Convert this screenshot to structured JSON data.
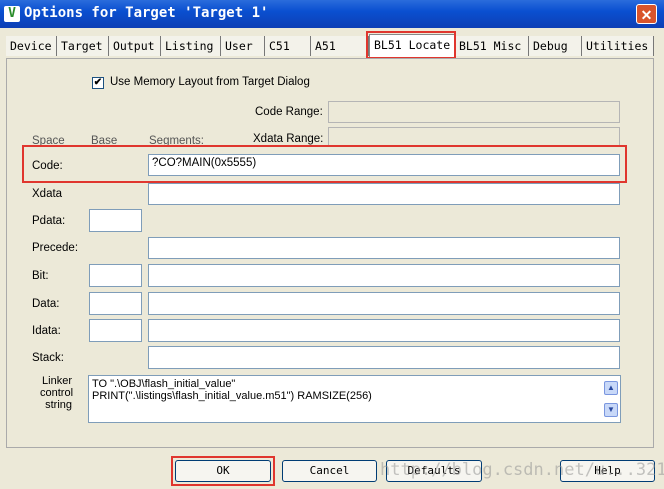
{
  "window": {
    "title": "Options for Target 'Target 1'",
    "icon_glyph": "V",
    "close_glyph": "✕"
  },
  "tabs": [
    {
      "label": "Device"
    },
    {
      "label": "Target"
    },
    {
      "label": "Output"
    },
    {
      "label": "Listing"
    },
    {
      "label": "User"
    },
    {
      "label": "C51"
    },
    {
      "label": "A51"
    },
    {
      "label": "BL51 Locate",
      "active": true
    },
    {
      "label": "BL51 Misc"
    },
    {
      "label": "Debug"
    },
    {
      "label": "Utilities"
    }
  ],
  "use_memory_layout": {
    "checked": true,
    "label": "Use Memory Layout from Target Dialog"
  },
  "headers": {
    "space": "Space",
    "base": "Base",
    "segments": "Segments:"
  },
  "code_range": {
    "label": "Code Range:",
    "value": ""
  },
  "xdata_range": {
    "label": "Xdata Range:",
    "value": ""
  },
  "rows": [
    {
      "label": "Code:",
      "base": "",
      "segments": "?CO?MAIN(0x5555)"
    },
    {
      "label": "Xdata",
      "base": "",
      "segments": ""
    },
    {
      "label": "Pdata:",
      "base": "",
      "segments": ""
    },
    {
      "label": "Precede:",
      "base": "",
      "segments": ""
    },
    {
      "label": "Bit:",
      "base": "",
      "segments": ""
    },
    {
      "label": "Data:",
      "base": "",
      "segments": ""
    },
    {
      "label": "Idata:",
      "base": "",
      "segments": ""
    },
    {
      "label": "Stack:",
      "base": "",
      "segments": ""
    }
  ],
  "linker": {
    "label_lines": [
      "Linker",
      "control",
      "string"
    ],
    "line1": "TO \".\\OBJ\\flash_initial_value\"",
    "line2": "PRINT(\".\\listings\\flash_initial_value.m51\") RAMSIZE(256)"
  },
  "buttons": {
    "ok": "OK",
    "cancel": "Cancel",
    "defaults": "Defaults",
    "help": "Help"
  },
  "watermark": "http://blog.csdn.net/u...321",
  "colors": {
    "highlight": "#e0362e",
    "titlebar": "#0a4fd0"
  }
}
